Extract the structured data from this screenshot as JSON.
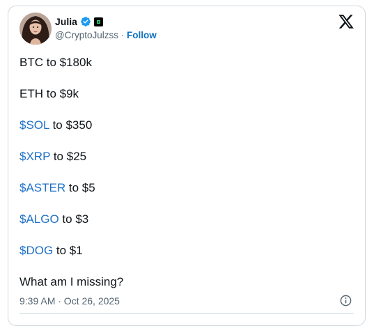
{
  "author": {
    "name": "Julia",
    "handle": "@CryptoJulzss",
    "separator": "·",
    "follow_label": "Follow",
    "verified_icon": "verified-badge-icon",
    "affiliate_icon": "affiliate-badge-icon"
  },
  "platform_icon": "x-logo-icon",
  "tweet": {
    "lines": [
      {
        "text": "BTC to $180k"
      },
      {
        "text": "ETH to $9k"
      },
      {
        "cashtag": "$SOL",
        "rest": " to $350"
      },
      {
        "cashtag": "$XRP",
        "rest": " to $25"
      },
      {
        "cashtag": "$ASTER",
        "rest": " to $5"
      },
      {
        "cashtag": "$ALGO",
        "rest": " to $3"
      },
      {
        "cashtag": "$DOG",
        "rest": " to $1"
      },
      {
        "text": "What am I missing?"
      }
    ]
  },
  "meta": {
    "timestamp": "9:39 AM · Oct 26, 2025",
    "info_icon": "info-icon"
  },
  "colors": {
    "cashtag": "#1d70c8",
    "follow": "#0f73bf",
    "verified": "#1d9bf0",
    "secondary_text": "#536471",
    "border": "#cfd9de"
  }
}
